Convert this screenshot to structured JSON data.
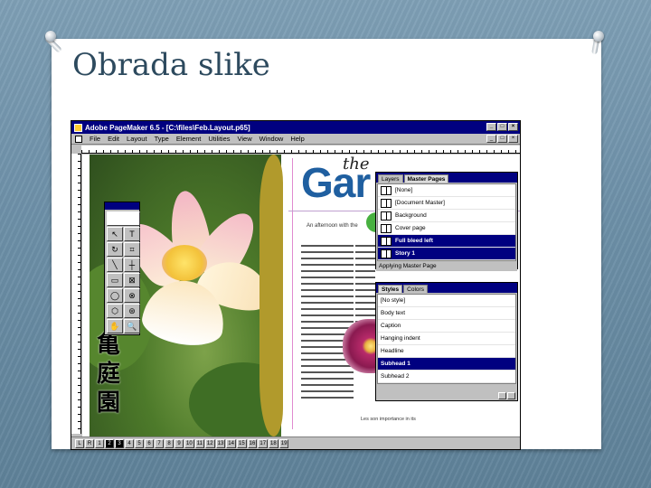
{
  "slide": {
    "title": "Obrada slike"
  },
  "app": {
    "window_title": "Adobe PageMaker 6.5 - [C:\\files\\Feb.Layout.p65]",
    "menu": [
      "File",
      "Edit",
      "Layout",
      "Type",
      "Element",
      "Utilities",
      "View",
      "Window",
      "Help"
    ],
    "window_buttons": [
      "_",
      "□",
      "×"
    ]
  },
  "toolbox": {
    "tools": [
      "pointer-tool",
      "text-tool",
      "rotate-tool",
      "crop-tool",
      "line-tool",
      "constrained-line-tool",
      "rectangle-tool",
      "rectangle-frame-tool",
      "ellipse-tool",
      "ellipse-frame-tool",
      "polygon-tool",
      "polygon-frame-tool",
      "hand-tool",
      "zoom-tool"
    ],
    "glyphs": [
      "↖",
      "T",
      "↻",
      "⌗",
      "╲",
      "┼",
      "▭",
      "⊠",
      "◯",
      "⊗",
      "⬡",
      "⊛",
      "✋",
      "🔍"
    ]
  },
  "layout_page": {
    "headline_prefix": "the",
    "headline": "Gar",
    "subtitle": "An afternoon with the",
    "bottom_text": "Les son importance in its",
    "kanji": [
      "亀",
      "庭",
      "園"
    ]
  },
  "master_pages_panel": {
    "tabs": [
      "Layers",
      "Master Pages"
    ],
    "items": [
      "[None]",
      "[Document Master]",
      "Background",
      "Cover page",
      "Full bleed left",
      "Story 1"
    ],
    "selected": [
      "Full bleed left",
      "Story 1"
    ],
    "footer": "Applying Master Page"
  },
  "styles_panel": {
    "tabs": [
      "Styles",
      "Colors"
    ],
    "items": [
      "[No style]",
      "Body text",
      "Caption",
      "Hanging indent",
      "Headline",
      "Subhead 1",
      "Subhead 2"
    ],
    "selected": [
      "Subhead 1"
    ]
  },
  "page_strip": {
    "labels": [
      "L",
      "R"
    ],
    "pages": [
      "1",
      "2",
      "3",
      "4",
      "5",
      "6",
      "7",
      "8",
      "9",
      "10",
      "11",
      "12",
      "13",
      "14",
      "15",
      "16",
      "17",
      "18",
      "19"
    ],
    "current": [
      "2",
      "3"
    ]
  },
  "colors": {
    "title": "#2d4a5e",
    "titlebar": "#000080",
    "headline": "#1f5fa0",
    "olive_band": "#b19a2c"
  }
}
